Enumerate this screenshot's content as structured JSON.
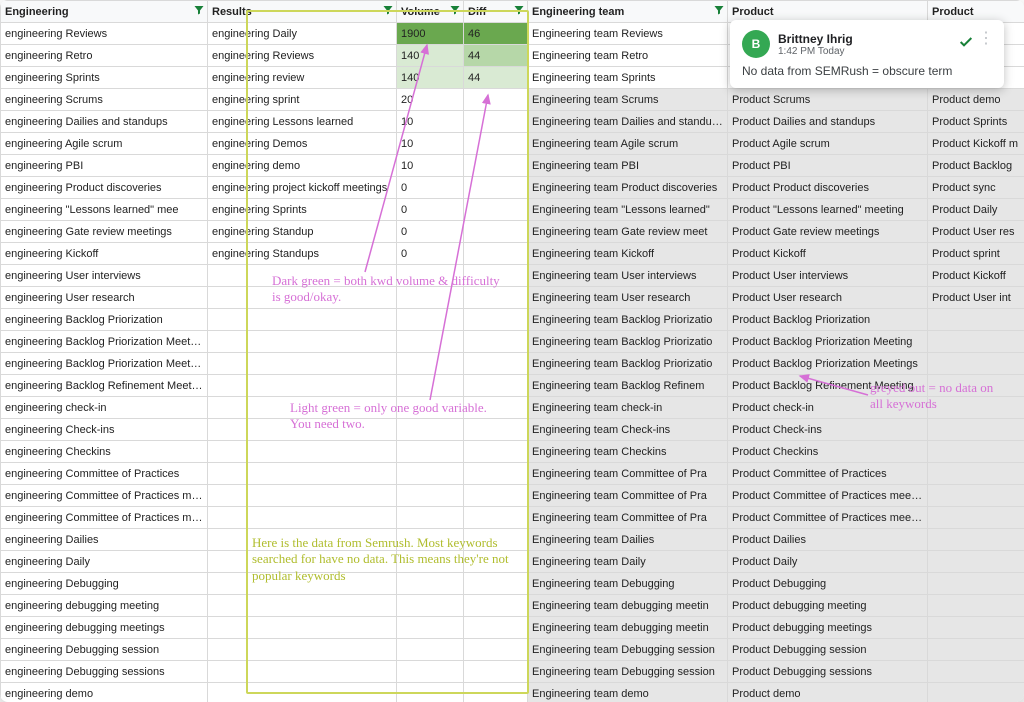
{
  "headers": {
    "c1": "Engineering",
    "c2": "Results",
    "c3": "Volume",
    "c4": "Diff",
    "c5": "Engineering team",
    "c6": "Product",
    "c7": "Product"
  },
  "rows": [
    {
      "c1": "engineering Reviews",
      "c2": "engineering Daily",
      "c3": "1900",
      "c4": "46",
      "c5": "Engineering team Reviews",
      "c6": "",
      "c7": "",
      "c3cls": "dark-green",
      "c4cls": "dark-green"
    },
    {
      "c1": "engineering Retro",
      "c2": "engineering Reviews",
      "c3": "140",
      "c4": "44",
      "c5": "Engineering team Retro",
      "c6": "",
      "c7": "",
      "c3cls": "lighter-green",
      "c4cls": "light-green"
    },
    {
      "c1": "engineering Sprints",
      "c2": "engineering review",
      "c3": "140",
      "c4": "44",
      "c5": "Engineering team Sprints",
      "c6": "",
      "c7": "",
      "c3cls": "lighter-green",
      "c4cls": "lighter-green"
    },
    {
      "c1": "engineering Scrums",
      "c2": "engineering sprint",
      "c3": "20",
      "c4": "",
      "c5": "Engineering team Scrums",
      "c6": "Product Scrums",
      "c7": "Product demo",
      "grey": true
    },
    {
      "c1": "engineering Dailies and standups",
      "c2": "engineering Lessons learned",
      "c3": "10",
      "c4": "",
      "c5": "Engineering team Dailies and standups",
      "c6": "Product Dailies and standups",
      "c7": "Product Sprints",
      "grey": true
    },
    {
      "c1": "engineering Agile scrum",
      "c2": "engineering Demos",
      "c3": "10",
      "c4": "",
      "c5": "Engineering team Agile scrum",
      "c6": "Product Agile scrum",
      "c7": "Product Kickoff m",
      "grey": true
    },
    {
      "c1": "engineering PBI",
      "c2": "engineering demo",
      "c3": "10",
      "c4": "",
      "c5": "Engineering team PBI",
      "c6": "Product PBI",
      "c7": "Product Backlog",
      "grey": true
    },
    {
      "c1": "engineering Product discoveries",
      "c2": "engineering project kickoff meetings",
      "c3": "0",
      "c4": "",
      "c5": "Engineering team Product discoveries",
      "c6": "Product Product discoveries",
      "c7": "Product sync",
      "grey": true
    },
    {
      "c1": "engineering \"Lessons learned\" mee",
      "c2": "engineering Sprints",
      "c3": "0",
      "c4": "",
      "c5": "Engineering team \"Lessons learned\"",
      "c6": "Product \"Lessons learned\" meeting",
      "c7": "Product Daily",
      "grey": true
    },
    {
      "c1": "engineering Gate review meetings",
      "c2": "engineering Standup",
      "c3": "0",
      "c4": "",
      "c5": "Engineering team Gate review meet",
      "c6": "Product Gate review meetings",
      "c7": "Product User res",
      "grey": true
    },
    {
      "c1": "engineering Kickoff",
      "c2": "engineering Standups",
      "c3": "0",
      "c4": "",
      "c5": "Engineering team Kickoff",
      "c6": "Product Kickoff",
      "c7": "Product sprint",
      "grey": true
    },
    {
      "c1": "engineering User interviews",
      "c2": "",
      "c3": "",
      "c4": "",
      "c5": "Engineering team User interviews",
      "c6": "Product User interviews",
      "c7": "Product Kickoff",
      "grey": true
    },
    {
      "c1": "engineering User research",
      "c2": "",
      "c3": "",
      "c4": "",
      "c5": "Engineering team User research",
      "c6": "Product User research",
      "c7": "Product User int",
      "grey": true
    },
    {
      "c1": "engineering Backlog Priorization",
      "c2": "",
      "c3": "",
      "c4": "",
      "c5": "Engineering team Backlog Priorizatio",
      "c6": "Product Backlog Priorization",
      "c7": "",
      "grey": true
    },
    {
      "c1": "engineering Backlog Priorization Meeting",
      "c2": "",
      "c3": "",
      "c4": "",
      "c5": "Engineering team Backlog Priorizatio",
      "c6": "Product Backlog Priorization Meeting",
      "c7": "",
      "grey": true
    },
    {
      "c1": "engineering Backlog Priorization Meetings",
      "c2": "",
      "c3": "",
      "c4": "",
      "c5": "Engineering team Backlog Priorizatio",
      "c6": "Product Backlog Priorization Meetings",
      "c7": "",
      "grey": true
    },
    {
      "c1": "engineering Backlog Refinement Meeting",
      "c2": "",
      "c3": "",
      "c4": "",
      "c5": "Engineering team Backlog Refinem",
      "c6": "Product Backlog Refinement Meeting",
      "c7": "",
      "grey": true
    },
    {
      "c1": "engineering check-in",
      "c2": "",
      "c3": "",
      "c4": "",
      "c5": "Engineering team check-in",
      "c6": "Product check-in",
      "c7": "",
      "grey": true
    },
    {
      "c1": "engineering Check-ins",
      "c2": "",
      "c3": "",
      "c4": "",
      "c5": "Engineering team Check-ins",
      "c6": "Product Check-ins",
      "c7": "",
      "grey": true
    },
    {
      "c1": "engineering Checkins",
      "c2": "",
      "c3": "",
      "c4": "",
      "c5": "Engineering team Checkins",
      "c6": "Product Checkins",
      "c7": "",
      "grey": true
    },
    {
      "c1": "engineering Committee of Practices",
      "c2": "",
      "c3": "",
      "c4": "",
      "c5": "Engineering team Committee of Pra",
      "c6": "Product Committee of Practices",
      "c7": "",
      "grey": true
    },
    {
      "c1": "engineering Committee of Practices meeting",
      "c2": "",
      "c3": "",
      "c4": "",
      "c5": "Engineering team Committee of Pra",
      "c6": "Product Committee of Practices meeting",
      "c7": "",
      "grey": true
    },
    {
      "c1": "engineering Committee of Practices meetings",
      "c2": "",
      "c3": "",
      "c4": "",
      "c5": "Engineering team Committee of Pra",
      "c6": "Product Committee of Practices meetings",
      "c7": "",
      "grey": true
    },
    {
      "c1": "engineering Dailies",
      "c2": "",
      "c3": "",
      "c4": "",
      "c5": "Engineering team Dailies",
      "c6": "Product Dailies",
      "c7": "",
      "grey": true
    },
    {
      "c1": "engineering Daily",
      "c2": "",
      "c3": "",
      "c4": "",
      "c5": "Engineering team Daily",
      "c6": "Product Daily",
      "c7": "",
      "grey": true
    },
    {
      "c1": "engineering Debugging",
      "c2": "",
      "c3": "",
      "c4": "",
      "c5": "Engineering team Debugging",
      "c6": "Product Debugging",
      "c7": "",
      "grey": true
    },
    {
      "c1": "engineering debugging meeting",
      "c2": "",
      "c3": "",
      "c4": "",
      "c5": "Engineering team debugging meetin",
      "c6": "Product debugging meeting",
      "c7": "",
      "grey": true
    },
    {
      "c1": "engineering debugging meetings",
      "c2": "",
      "c3": "",
      "c4": "",
      "c5": "Engineering team debugging meetin",
      "c6": "Product debugging meetings",
      "c7": "",
      "grey": true
    },
    {
      "c1": "engineering Debugging session",
      "c2": "",
      "c3": "",
      "c4": "",
      "c5": "Engineering team Debugging session",
      "c6": "Product Debugging session",
      "c7": "",
      "grey": true
    },
    {
      "c1": "engineering Debugging sessions",
      "c2": "",
      "c3": "",
      "c4": "",
      "c5": "Engineering team Debugging session",
      "c6": "Product Debugging sessions",
      "c7": "",
      "grey": true
    },
    {
      "c1": "engineering demo",
      "c2": "",
      "c3": "",
      "c4": "",
      "c5": "Engineering team demo",
      "c6": "Product demo",
      "c7": "",
      "grey": true
    }
  ],
  "comment": {
    "author": "Brittney Ihrig",
    "time": "1:42 PM Today",
    "body": "No data from SEMRush = obscure term"
  },
  "annotations": {
    "semrush_box": "Here is the data from Semrush. Most keywords searched for have no data. This means they're not popular keywords",
    "dark_green": "Dark green = both kwd volume & difficulty is good/okay.",
    "light_green": "Light green = only one good variable. You need two.",
    "greyed": "greyed out = no data on all keywords"
  }
}
